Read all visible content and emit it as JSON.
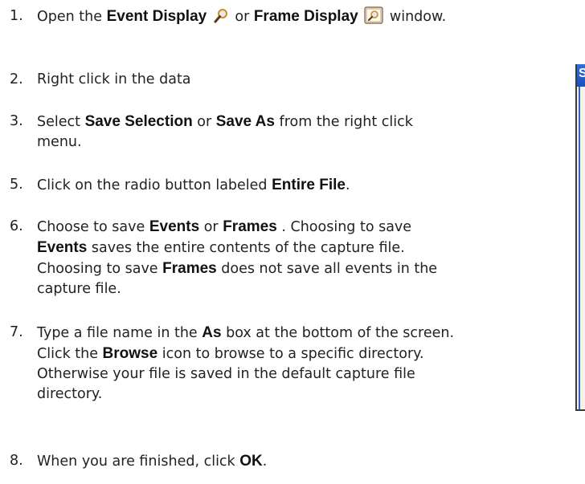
{
  "steps": [
    {
      "number": "1.",
      "parts": [
        {
          "t": "Open the "
        },
        {
          "b": "Event Display"
        },
        {
          "icon": "magnifier-icon"
        },
        {
          "t": " or "
        },
        {
          "b": "Frame Display"
        },
        {
          "icon": "frame-display-icon"
        },
        {
          "t": " window."
        }
      ]
    },
    {
      "number": "2.",
      "parts": [
        {
          "t": "Right click in the data"
        }
      ]
    },
    {
      "number": "3.",
      "parts": [
        {
          "t": "Select "
        },
        {
          "b": "Save Selection"
        },
        {
          "t": " or "
        },
        {
          "b": "Save As"
        },
        {
          "t": " from the right click"
        },
        {
          "br": true
        },
        {
          "t": "menu."
        }
      ]
    },
    {
      "number": "5.",
      "parts": [
        {
          "t": "Click on the radio button labeled "
        },
        {
          "b": "Entire File"
        },
        {
          "t": "."
        }
      ]
    },
    {
      "number": "6.",
      "parts": [
        {
          "t": "Choose to save "
        },
        {
          "b": "Events"
        },
        {
          "t": " or "
        },
        {
          "b": "Frames"
        },
        {
          "t": " . Choosing to save"
        },
        {
          "br": true
        },
        {
          "b": "Events"
        },
        {
          "t": " saves the entire contents of the capture file."
        },
        {
          "br": true
        },
        {
          "t": "Choosing to save "
        },
        {
          "b": "Frames"
        },
        {
          "t": " does not save all events in the"
        },
        {
          "br": true
        },
        {
          "t": "capture file."
        }
      ]
    },
    {
      "number": "7.",
      "parts": [
        {
          "t": "Type a file name in the "
        },
        {
          "b": "As"
        },
        {
          "t": " box at the bottom of the screen."
        },
        {
          "br": true
        },
        {
          "t": "Click the "
        },
        {
          "b": "Browse"
        },
        {
          "t": " icon to browse to a specific directory."
        },
        {
          "br": true
        },
        {
          "t": "Otherwise your file is saved in the default capture file"
        },
        {
          "br": true
        },
        {
          "t": "directory."
        }
      ]
    },
    {
      "number": "8.",
      "parts": [
        {
          "t": "When you are finished, click "
        },
        {
          "b": "OK"
        },
        {
          "t": "."
        }
      ]
    }
  ],
  "dialog": {
    "title_fragment": "S"
  },
  "colors": {
    "text": "#222222",
    "dialog_title": "#2f6fe0",
    "dialog_border": "#3a3a3a"
  }
}
